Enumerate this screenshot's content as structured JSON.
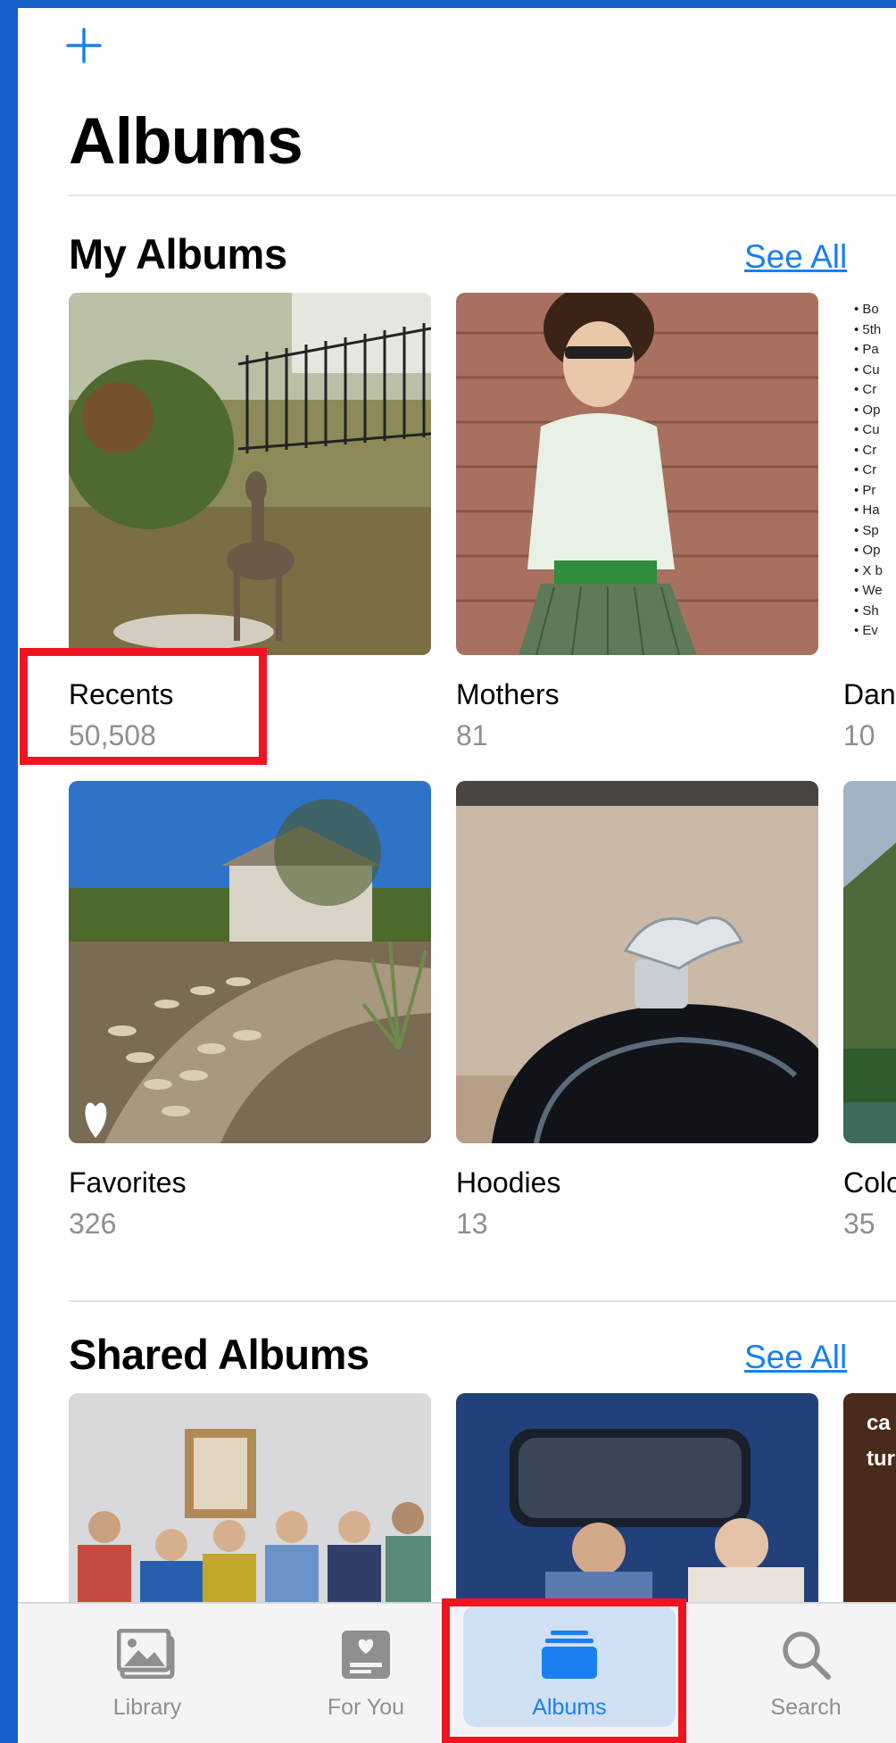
{
  "header": {
    "title": "Albums",
    "add_icon": "plus-icon"
  },
  "my_albums": {
    "title": "My Albums",
    "see_all": "See All",
    "items": [
      {
        "name": "Recents",
        "count": "50,508"
      },
      {
        "name": "Mothers",
        "count": "81"
      },
      {
        "name": "Dan",
        "count": "10"
      },
      {
        "name": "Favorites",
        "count": "326"
      },
      {
        "name": "Hoodies",
        "count": "13"
      },
      {
        "name": "Colc",
        "count": "35"
      }
    ],
    "notes_lines": [
      "Bo",
      "5th",
      "Pa",
      "Cu",
      "Cr",
      "Op",
      "Cu",
      "Cr",
      "Cr",
      "Pr",
      "Ha",
      "Sp",
      "Op",
      "X b",
      "We",
      "Sh",
      "Ev"
    ]
  },
  "shared_albums": {
    "title": "Shared Albums",
    "see_all": "See All",
    "peek_text": [
      "ca",
      "tur"
    ]
  },
  "tab_bar": {
    "tabs": [
      {
        "label": "Library",
        "icon": "photos-icon"
      },
      {
        "label": "For You",
        "icon": "for-you-icon"
      },
      {
        "label": "Albums",
        "icon": "albums-icon",
        "active": true
      },
      {
        "label": "Search",
        "icon": "search-icon"
      }
    ]
  },
  "colors": {
    "accent": "#1a7ff0",
    "highlight": "#ef1520",
    "background_frame": "#1560c8"
  }
}
